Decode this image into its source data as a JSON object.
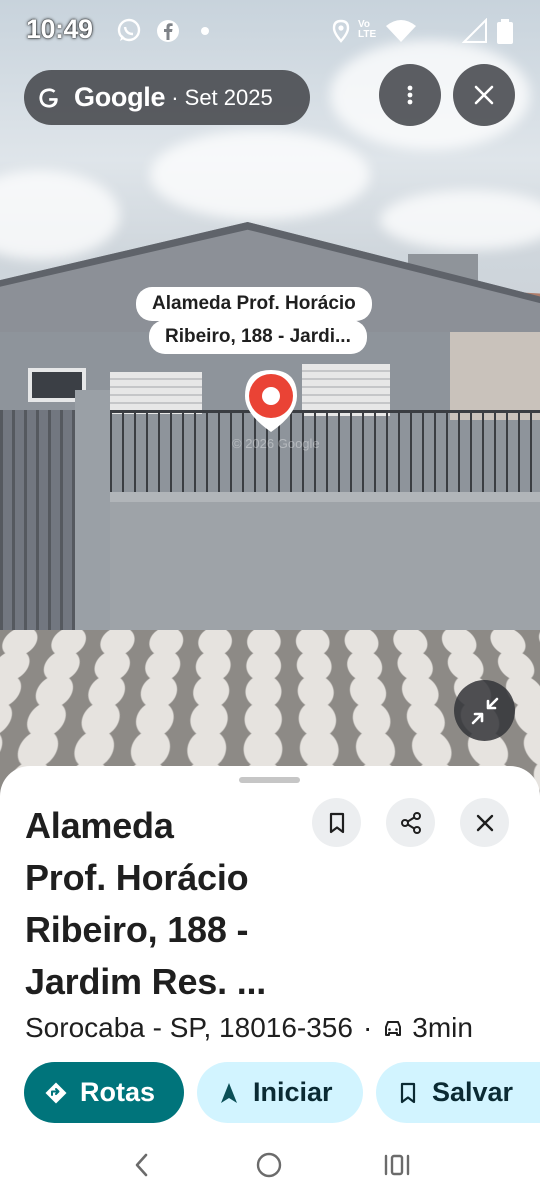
{
  "status_bar": {
    "time": "10:49",
    "icons": [
      "whatsapp-icon",
      "facebook-icon",
      "dot-icon",
      "location-icon",
      "volte-icon",
      "wifi-icon",
      "signal-icon",
      "battery-icon"
    ],
    "volte_text": "Vo LTE"
  },
  "overlay": {
    "brand": "Google",
    "date": "· Set 2025",
    "location_label_line1": "Alameda Prof. Horácio",
    "location_label_line2": "Ribeiro, 188 - Jardi...",
    "watermark": "© 2026 Google",
    "pin_color": "#ea4335"
  },
  "place": {
    "title_lines": [
      "Alameda",
      "Prof. Horácio",
      "Ribeiro, 188 -",
      "Jardim Res. ..."
    ],
    "address": "Sorocaba - SP, 18016-356",
    "separator": "·",
    "travel_time": "3min"
  },
  "actions": {
    "routes_label": "Rotas",
    "start_label": "Iniciar",
    "save_label": "Salvar"
  },
  "colors": {
    "primary_chip": "#00747b",
    "secondary_chip": "#d2f4ff",
    "overlay_pill": "#46484c"
  }
}
